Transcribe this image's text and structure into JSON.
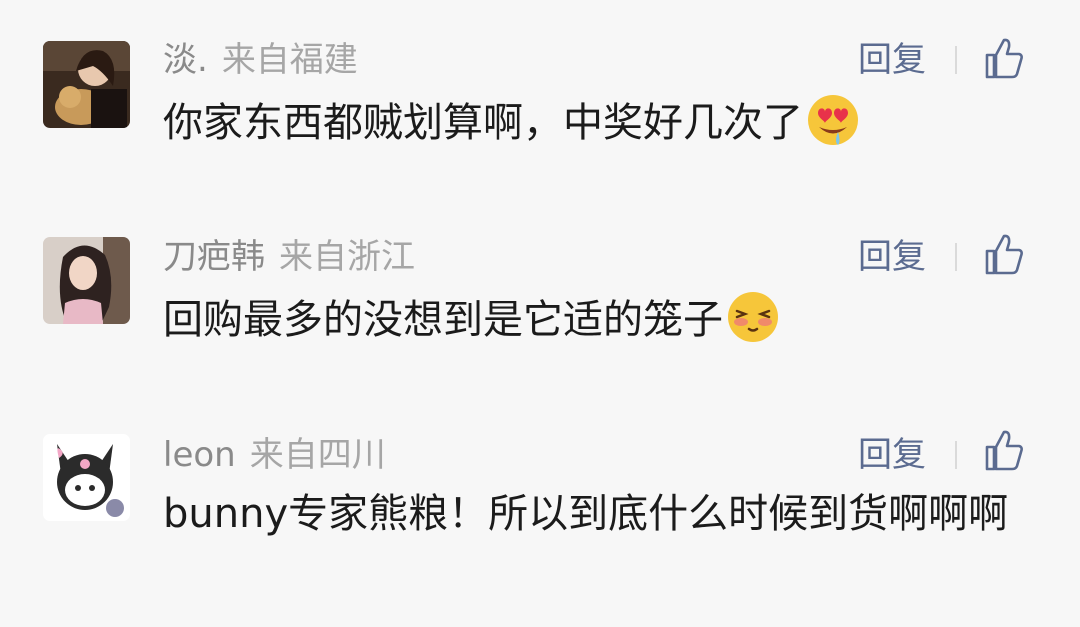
{
  "comments": [
    {
      "username": "淡.",
      "location": "来自福建",
      "reply_label": "回复",
      "text": "你家东西都贼划算啊，中奖好几次了",
      "emoji": "heart-eyes-drooling"
    },
    {
      "username": "刀疤韩",
      "location": "来自浙江",
      "reply_label": "回复",
      "text": "回购最多的没想到是它适的笼子",
      "emoji": "shy-blushing"
    },
    {
      "username": "leon",
      "location": "来自四川",
      "reply_label": "回复",
      "text": "bunny专家熊粮！所以到底什么时候到货啊啊啊"
    }
  ],
  "colors": {
    "username": "#8a8a8a",
    "reply": "#5b6b90",
    "text": "#1b1b1b",
    "background": "#f7f7f7"
  }
}
